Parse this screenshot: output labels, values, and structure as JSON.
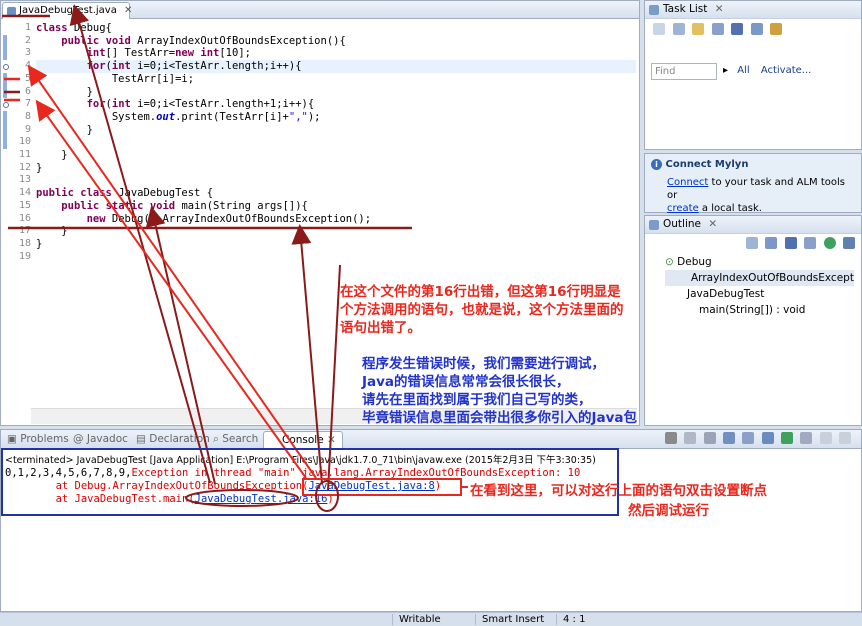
{
  "editor": {
    "tab_label": "JavaDebugTest.java",
    "line_numbers": [
      "1",
      "2",
      "3",
      "4",
      "5",
      "6",
      "7",
      "8",
      "9",
      "10",
      "11",
      "12",
      "13",
      "14",
      "15",
      "16",
      "17",
      "18",
      "19"
    ]
  },
  "task_list": {
    "title": "Task List",
    "find_placeholder": "Find",
    "all_label": "All",
    "activate_label": "Activate..."
  },
  "mylyn": {
    "title": "Connect Mylyn",
    "connect_link": "Connect",
    "connect_text": " to your task and ALM tools or",
    "create_link": "create",
    "create_text": " a local task."
  },
  "outline": {
    "title": "Outline",
    "items": [
      "Debug",
      "ArrayIndexOutOfBoundsExcept",
      "JavaDebugTest",
      "main(String[]) : void"
    ]
  },
  "console": {
    "tabs": [
      "Problems",
      "Javadoc",
      "Declaration",
      "Search",
      "Console"
    ],
    "terminated": "<terminated> JavaDebugTest [Java Application] E:\\Program Files\\Java\\jdk1.7.0_71\\bin\\javaw.exe (2015年2月3日 下午3:30:35)",
    "out_line": "0,1,2,3,4,5,6,7,8,9,",
    "exception": "Exception in thread \"main\" java.lang.ArrayIndexOutOfBoundsException: 10",
    "at1_prefix": "\tat Debug.ArrayIndexOutOfBoundsException(",
    "at1_link": "JavaDebugTest.java:8",
    "at2_prefix": "\tat JavaDebugTest.main(",
    "at2_link": "JavaDebugTest.java:16",
    "close_paren": ")"
  },
  "status": {
    "writable": "Writable",
    "insert": "Smart Insert",
    "position": "4 : 1"
  },
  "annotations": {
    "note1": "在这个文件的第16行出错，但这第16行明显是个方法调用的语句，也就是说，这个方法里面的语句出错了。",
    "note2_lines": [
      "程序发生错误时候，我们需要进行调试，",
      "Java的错误信息常常会很长很长，",
      "请先在里面找到属于我们自己写的类，",
      "毕竟错误信息里面会带出很多你引入的Java包"
    ],
    "note3_line1": "在看到这里，可以对这行上面的语句双击设置断点",
    "note3_line2": "然后调试运行"
  },
  "colors": {
    "annotation_red": "#e8281e",
    "annotation_blue": "#2233cc",
    "arrow_dark": "#8b1a1a",
    "box_blue": "#2233aa"
  }
}
